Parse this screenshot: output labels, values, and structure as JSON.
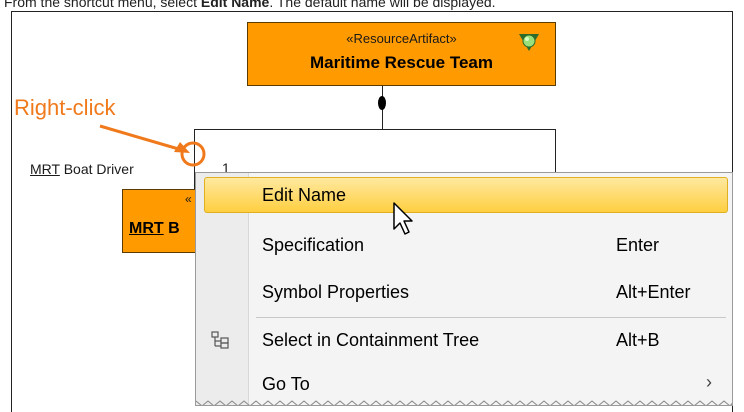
{
  "instruction": {
    "prefix": "From the shortcut menu, select ",
    "command": "Edit Name",
    "suffix": ". The default name will be displayed."
  },
  "diagram": {
    "top_block": {
      "stereotype": "«ResourceArtifact»",
      "name": "Maritime Rescue Team"
    },
    "bottom_block": {
      "stereotype": "«",
      "name_underlined": "MRT",
      "name_rest": " B"
    },
    "part_label": {
      "name_underlined": "MRT",
      "name_rest": " Boat Driver"
    },
    "multiplicity": "1",
    "annotation": "Right-click"
  },
  "context_menu": {
    "items": [
      {
        "label": "Edit Name",
        "shortcut": "",
        "highlighted": true
      },
      {
        "label": "Specification",
        "shortcut": "Enter"
      },
      {
        "label": "Symbol Properties",
        "shortcut": "Alt+Enter"
      },
      {
        "label": "Select in Containment Tree",
        "shortcut": "Alt+B",
        "icon": "containment-tree-icon"
      },
      {
        "label": "Go To",
        "shortcut": "",
        "submenu": true,
        "arrow": "›"
      }
    ]
  },
  "colors": {
    "block_fill": "#ff9a00",
    "annotation": "#f07a1b",
    "highlight": "#ffcf40"
  }
}
